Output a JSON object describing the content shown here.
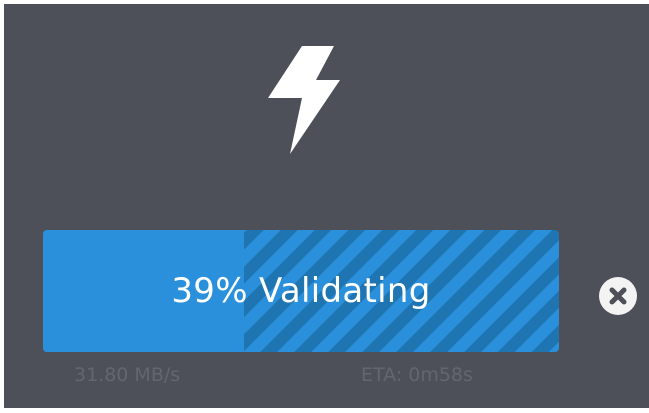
{
  "icon": "lightning-bolt-icon",
  "progress": {
    "percent_label": "39%",
    "status": "Validating",
    "fill_fraction": 0.39,
    "speed": "31.80 MB/s",
    "eta": "ETA: 0m58s"
  },
  "cancel_icon": "close-icon",
  "colors": {
    "background": "#4d5059",
    "bar": "#2b90db",
    "bar_stripe": "#1f75b1",
    "secondary_text": "#626671",
    "cancel_button": "#f3f3f3"
  }
}
